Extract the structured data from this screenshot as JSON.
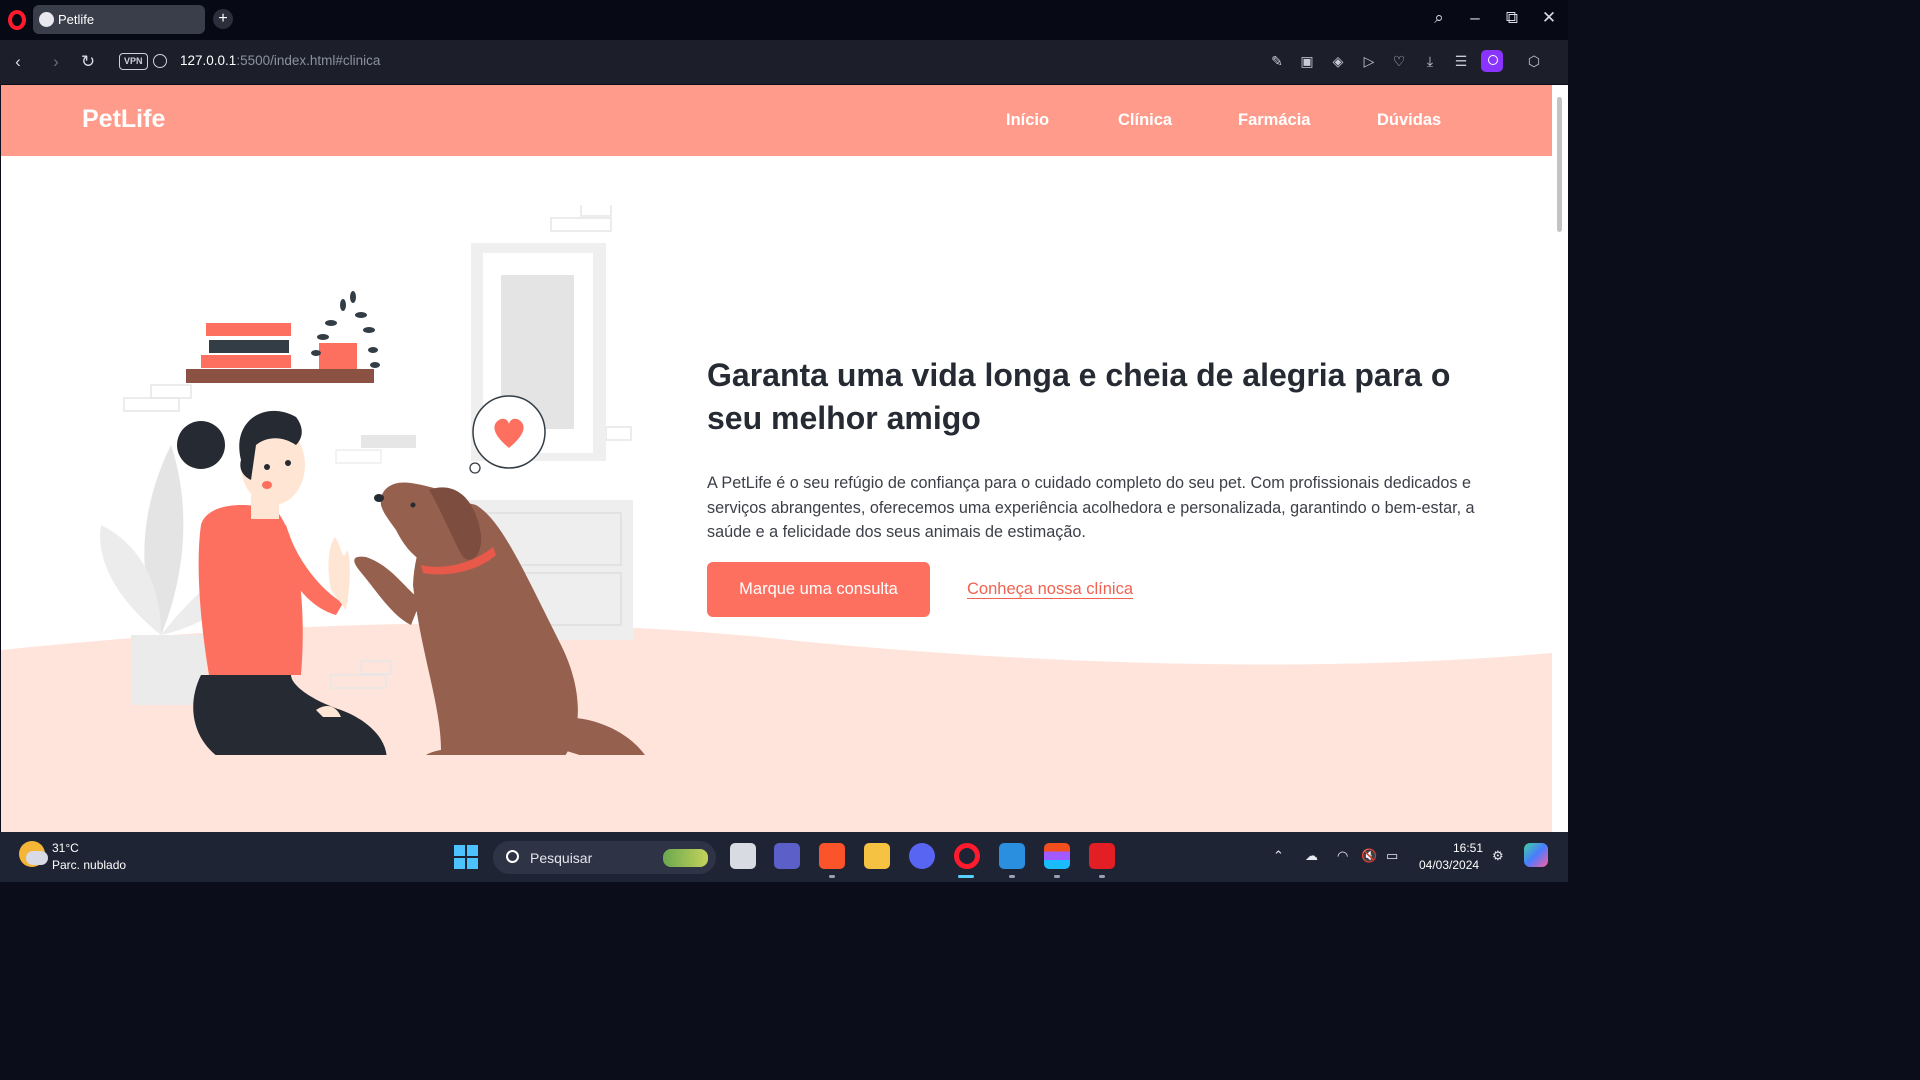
{
  "browser": {
    "tab_title": "Petlife",
    "new_tab_label": "+",
    "vpn_label": "VPN",
    "url_host": "127.0.0.1",
    "url_rest": ":5500/index.html#clinica"
  },
  "site": {
    "brand": "PetLife",
    "nav": [
      {
        "label": "Início"
      },
      {
        "label": "Clínica"
      },
      {
        "label": "Farmácia"
      },
      {
        "label": "Dúvidas"
      }
    ],
    "hero": {
      "title": "Garanta uma vida longa e cheia de alegria para o seu melhor amigo",
      "text": "A PetLife é o seu refúgio de confiança para o cuidado completo do seu pet. Com profissionais dedicados e serviços abrangentes, oferecemos uma experiência acolhedora e personalizada, garantindo o bem-estar, a saúde e a felicidade dos seus animais de estimação.",
      "cta_button": "Marque uma consulta",
      "cta_link": "Conheça nossa clínica"
    },
    "colors": {
      "header": "#ff9b8b",
      "accent": "#fd6f5e",
      "wave": "#ffe4dc"
    }
  },
  "taskbar": {
    "weather_temp": "31°C",
    "weather_cond": "Parc. nublado",
    "search_label": "Pesquisar",
    "time": "16:51",
    "date": "04/03/2024",
    "apps": [
      "file-explorer-multitask",
      "teams",
      "brave",
      "file-explorer",
      "discord",
      "opera",
      "vscode",
      "figma",
      "avira"
    ]
  }
}
